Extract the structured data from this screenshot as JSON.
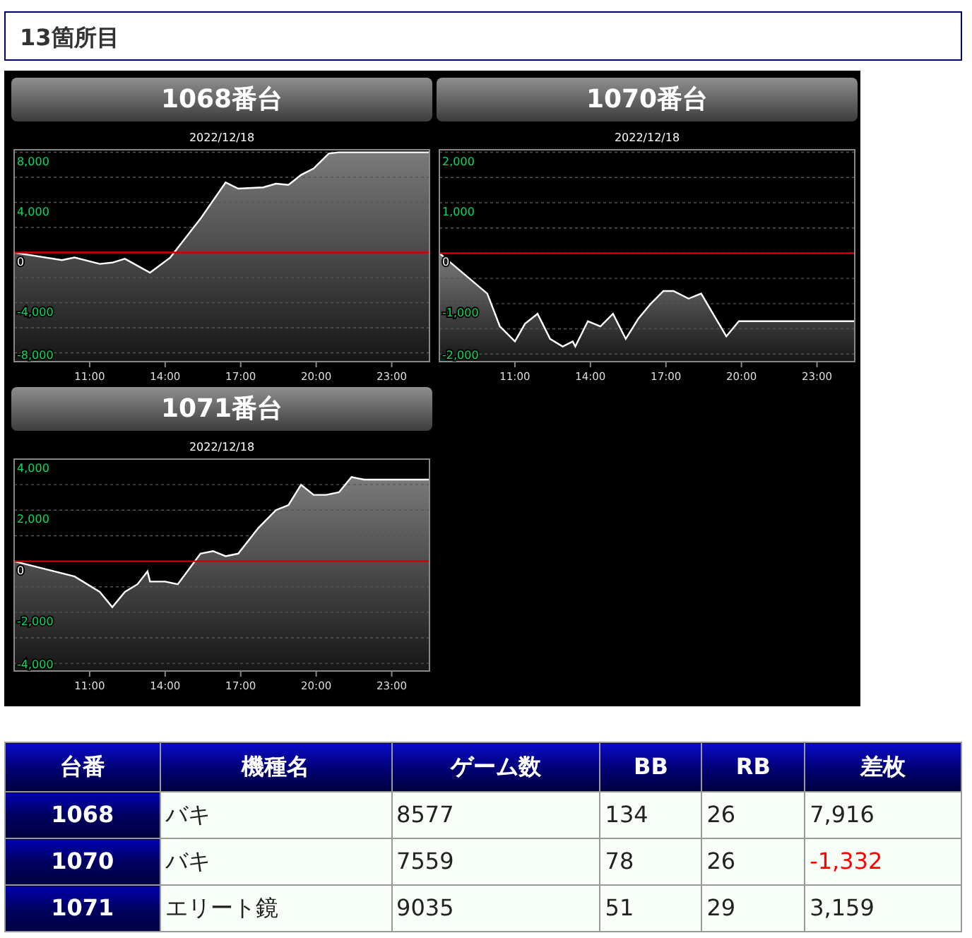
{
  "heading": "13箇所目",
  "panels": [
    {
      "label": "1068番台",
      "chart_data": {
        "type": "line",
        "title": "2022/12/18",
        "xlim": [
          8,
          24.5
        ],
        "ylim": [
          -8700,
          8200
        ],
        "xticks": [
          {
            "value": 11,
            "label": "11:00"
          },
          {
            "value": 14,
            "label": "14:00"
          },
          {
            "value": 17,
            "label": "17:00"
          },
          {
            "value": 20,
            "label": "20:00"
          },
          {
            "value": 23,
            "label": "23:00"
          }
        ],
        "yticks": [
          {
            "value": 8000,
            "label": "8,000"
          },
          {
            "value": 4000,
            "label": "4,000"
          },
          {
            "value": 0,
            "label": "0"
          },
          {
            "value": -4000,
            "label": "-4,000"
          },
          {
            "value": -8000,
            "label": "-8,000"
          }
        ],
        "x": [
          8.0,
          9.9,
          10.4,
          11.4,
          11.9,
          12.4,
          13.4,
          14.2,
          15.4,
          16.4,
          16.9,
          17.9,
          18.4,
          18.9,
          19.4,
          19.9,
          20.5,
          20.9,
          24.5
        ],
        "series": [
          {
            "color": "#ffffff",
            "values": [
              0,
              -600,
              -400,
              -900,
              -800,
              -500,
              -1600,
              -400,
              2700,
              5600,
              5100,
              5200,
              5500,
              5400,
              6200,
              6700,
              7900,
              8000,
              8000
            ]
          }
        ],
        "ref_lines": [
          {
            "axis": "y",
            "value": 0
          }
        ],
        "grid": true
      }
    },
    {
      "label": "1070番台",
      "chart_data": {
        "type": "line",
        "title": "2022/12/18",
        "xlim": [
          8,
          24.5
        ],
        "ylim": [
          -2150,
          2050
        ],
        "xticks": [
          {
            "value": 11,
            "label": "11:00"
          },
          {
            "value": 14,
            "label": "14:00"
          },
          {
            "value": 17,
            "label": "17:00"
          },
          {
            "value": 20,
            "label": "20:00"
          },
          {
            "value": 23,
            "label": "23:00"
          }
        ],
        "yticks": [
          {
            "value": 2000,
            "label": "2,000"
          },
          {
            "value": 1000,
            "label": "1,000"
          },
          {
            "value": 0,
            "label": "0"
          },
          {
            "value": -1000,
            "label": "-1,000"
          },
          {
            "value": -2000,
            "label": "-2,000"
          }
        ],
        "x": [
          8.0,
          9.9,
          10.4,
          11.0,
          11.4,
          11.9,
          12.4,
          12.9,
          13.3,
          13.4,
          13.9,
          14.4,
          14.9,
          15.4,
          15.9,
          16.4,
          16.9,
          17.3,
          17.9,
          18.4,
          19.4,
          19.9,
          24.5
        ],
        "series": [
          {
            "color": "#ffffff",
            "values": [
              0,
              -800,
              -1450,
              -1750,
              -1400,
              -1200,
              -1700,
              -1850,
              -1750,
              -1850,
              -1350,
              -1450,
              -1200,
              -1700,
              -1300,
              -1000,
              -750,
              -750,
              -900,
              -800,
              -1650,
              -1350,
              -1350
            ]
          }
        ],
        "ref_lines": [
          {
            "axis": "y",
            "value": 0
          }
        ],
        "grid": true
      }
    },
    {
      "label": "1071番台",
      "chart_data": {
        "type": "line",
        "title": "2022/12/18",
        "xlim": [
          8,
          24.5
        ],
        "ylim": [
          -4300,
          4000
        ],
        "xticks": [
          {
            "value": 11,
            "label": "11:00"
          },
          {
            "value": 14,
            "label": "14:00"
          },
          {
            "value": 17,
            "label": "17:00"
          },
          {
            "value": 20,
            "label": "20:00"
          },
          {
            "value": 23,
            "label": "23:00"
          }
        ],
        "yticks": [
          {
            "value": 4000,
            "label": "4,000"
          },
          {
            "value": 2000,
            "label": "2,000"
          },
          {
            "value": 0,
            "label": "0"
          },
          {
            "value": -2000,
            "label": "-2,000"
          },
          {
            "value": -4000,
            "label": "-4,000"
          }
        ],
        "x": [
          8.0,
          10.4,
          11.4,
          11.9,
          12.4,
          12.9,
          13.3,
          13.4,
          14.0,
          14.5,
          15.4,
          15.9,
          16.4,
          16.9,
          17.7,
          18.4,
          18.9,
          19.4,
          19.9,
          20.4,
          20.9,
          21.4,
          21.9,
          24.5
        ],
        "series": [
          {
            "color": "#ffffff",
            "values": [
              0,
              -600,
              -1200,
              -1800,
              -1200,
              -900,
              -400,
              -800,
              -800,
              -900,
              300,
              400,
              200,
              300,
              1300,
              2000,
              2200,
              3000,
              2600,
              2600,
              2700,
              3300,
              3200,
              3200
            ]
          }
        ],
        "ref_lines": [
          {
            "axis": "y",
            "value": 0
          }
        ],
        "grid": true
      }
    }
  ],
  "table": {
    "columns": [
      "台番",
      "機種名",
      "ゲーム数",
      "BB",
      "RB",
      "差枚"
    ],
    "rows": [
      {
        "cells": [
          "1068",
          "バキ",
          "8577",
          "134",
          "26",
          "7,916"
        ],
        "diff_negative": false
      },
      {
        "cells": [
          "1070",
          "バキ",
          "7559",
          "78",
          "26",
          "-1,332"
        ],
        "diff_negative": true
      },
      {
        "cells": [
          "1071",
          "エリート鏡",
          "9035",
          "51",
          "29",
          "3,159"
        ],
        "diff_negative": false
      }
    ]
  }
}
